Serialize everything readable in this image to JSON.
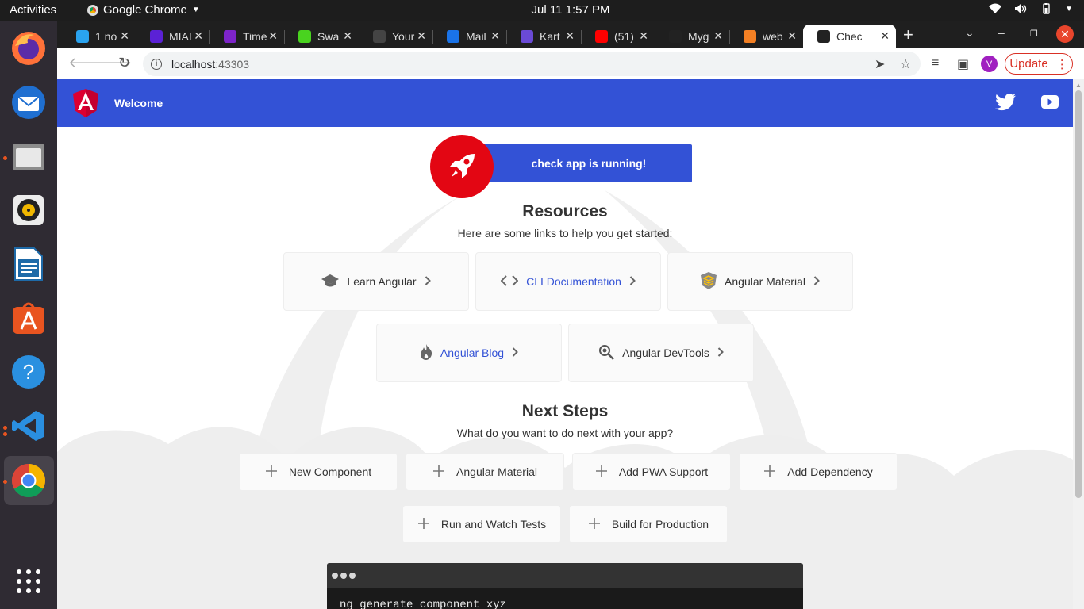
{
  "topbar": {
    "activities": "Activities",
    "app_name": "Google Chrome",
    "clock": "Jul 11  1:57 PM"
  },
  "tabs": [
    {
      "label": "1 no",
      "fav_color": "#2aa3ef"
    },
    {
      "label": "MIAI",
      "fav_color": "#5b21d6"
    },
    {
      "label": "Time",
      "fav_color": "#7d24c9"
    },
    {
      "label": "Swa",
      "fav_color": "#49d31f"
    },
    {
      "label": "Your",
      "fav_color": "#444"
    },
    {
      "label": "Mail",
      "fav_color": "#1a73e8"
    },
    {
      "label": "Kart",
      "fav_color": "#6a4ad6"
    },
    {
      "label": "(51)",
      "fav_color": "#ff0000"
    },
    {
      "label": "Myg",
      "fav_color": "#222"
    },
    {
      "label": "web",
      "fav_color": "#f48024"
    },
    {
      "label": "Chec",
      "fav_color": "#222"
    }
  ],
  "address": {
    "host": "localhost",
    "port": ":43303"
  },
  "toolbar": {
    "avatar_letter": "V",
    "update_label": "Update"
  },
  "angular": {
    "welcome": "Welcome",
    "banner_text": "check app is running!",
    "resources_title": "Resources",
    "resources_subtitle": "Here are some links to help you get started:",
    "resources": [
      {
        "label": "Learn Angular",
        "icon": "graduation-cap-icon",
        "link": false
      },
      {
        "label": "CLI Documentation",
        "icon": "code-icon",
        "link": true
      },
      {
        "label": "Angular Material",
        "icon": "material-icon",
        "link": false
      },
      {
        "label": "Angular Blog",
        "icon": "flame-icon",
        "link": true
      },
      {
        "label": "Angular DevTools",
        "icon": "devtools-icon",
        "link": false
      }
    ],
    "next_title": "Next Steps",
    "next_subtitle": "What do you want to do next with your app?",
    "steps": [
      "New Component",
      "Angular Material",
      "Add PWA Support",
      "Add Dependency",
      "Run and Watch Tests",
      "Build for Production"
    ],
    "terminal_command": "ng generate component xyz"
  },
  "colors": {
    "angular_blue": "#3352d6",
    "angular_red": "#e30613",
    "update_red": "#d93025"
  }
}
